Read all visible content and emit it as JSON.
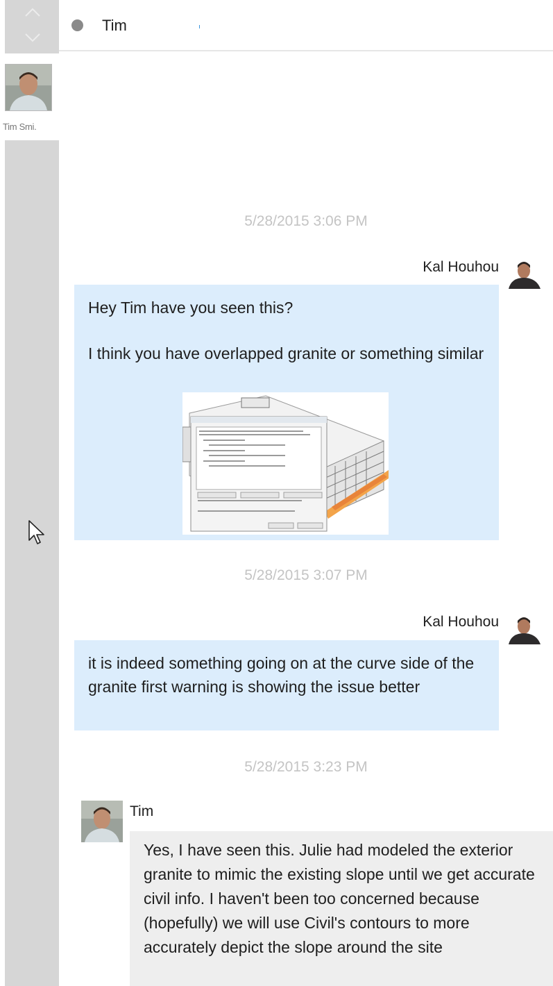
{
  "header": {
    "contact_name": "Tim",
    "status_color": "#8a8a8a",
    "icons": [
      "chevron-up-icon",
      "chevron-down-icon",
      "presence-dot-icon"
    ]
  },
  "sidebar": {
    "contact_label": "Tim Smi."
  },
  "messages": [
    {
      "timestamp": "5/28/2015 3:06 PM",
      "sender": "Kal Houhou",
      "direction": "outgoing",
      "paragraphs": [
        "Hey Tim have you seen this?",
        "I think you have overlapped granite or something similar"
      ],
      "has_image": true
    },
    {
      "timestamp": "5/28/2015 3:07 PM",
      "sender": "Kal Houhou",
      "direction": "outgoing",
      "paragraphs": [
        "it is indeed something going on at the curve side of the granite first warning is showing the issue better"
      ]
    },
    {
      "timestamp": "5/28/2015 3:23 PM",
      "sender": "Tim",
      "direction": "incoming",
      "paragraphs": [
        "Yes, I have seen this. Julie had modeled the exterior granite to mimic the existing slope until we get accurate civil info. I haven't been too concerned because (hopefully) we will use Civil's contours to more accurately depict the slope around the site"
      ]
    }
  ],
  "colors": {
    "outgoing_bubble": "#dcedfc",
    "incoming_bubble": "#eeeeee",
    "rail": "#d6d6d6",
    "timestamp_text": "#c4c4c4"
  }
}
